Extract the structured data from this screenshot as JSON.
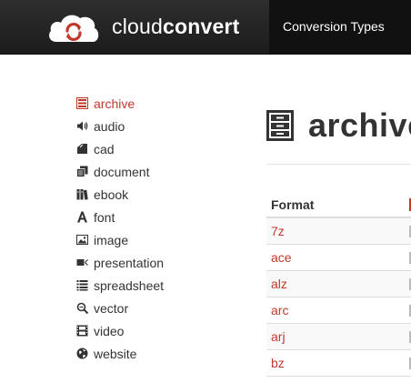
{
  "header": {
    "brand_regular": "cloud",
    "brand_bold": "convert",
    "nav_link": "Conversion Types",
    "logo_colors": {
      "cloud": "#ffffff",
      "arrows": "#c0392b"
    }
  },
  "sidebar": {
    "items": [
      {
        "label": "archive",
        "icon": "archive-icon",
        "active": true
      },
      {
        "label": "audio",
        "icon": "volume-icon",
        "active": false
      },
      {
        "label": "cad",
        "icon": "cad-icon",
        "active": false
      },
      {
        "label": "document",
        "icon": "documents-icon",
        "active": false
      },
      {
        "label": "ebook",
        "icon": "book-icon",
        "active": false
      },
      {
        "label": "font",
        "icon": "font-icon",
        "active": false
      },
      {
        "label": "image",
        "icon": "picture-icon",
        "active": false
      },
      {
        "label": "presentation",
        "icon": "presentation-icon",
        "active": false
      },
      {
        "label": "spreadsheet",
        "icon": "list-icon",
        "active": false
      },
      {
        "label": "vector",
        "icon": "vector-icon",
        "active": false
      },
      {
        "label": "video",
        "icon": "film-icon",
        "active": false
      },
      {
        "label": "website",
        "icon": "globe-icon",
        "active": false
      }
    ]
  },
  "main": {
    "title": "archive",
    "title_icon": "archive-icon",
    "table": {
      "header": "Format",
      "rows": [
        "7z",
        "ace",
        "alz",
        "arc",
        "arj",
        "bz"
      ]
    }
  },
  "colors": {
    "accent": "#c0392b",
    "header_bg": "#222222",
    "text": "#333333"
  }
}
